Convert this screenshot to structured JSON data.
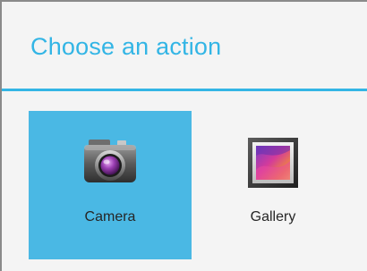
{
  "dialog": {
    "title": "Choose an action",
    "accent_color": "#33b5e5",
    "selected_tile_color": "#4ab8e4"
  },
  "apps": [
    {
      "label": "Camera",
      "icon": "camera-icon",
      "selected": true
    },
    {
      "label": "Gallery",
      "icon": "gallery-icon",
      "selected": false
    }
  ]
}
